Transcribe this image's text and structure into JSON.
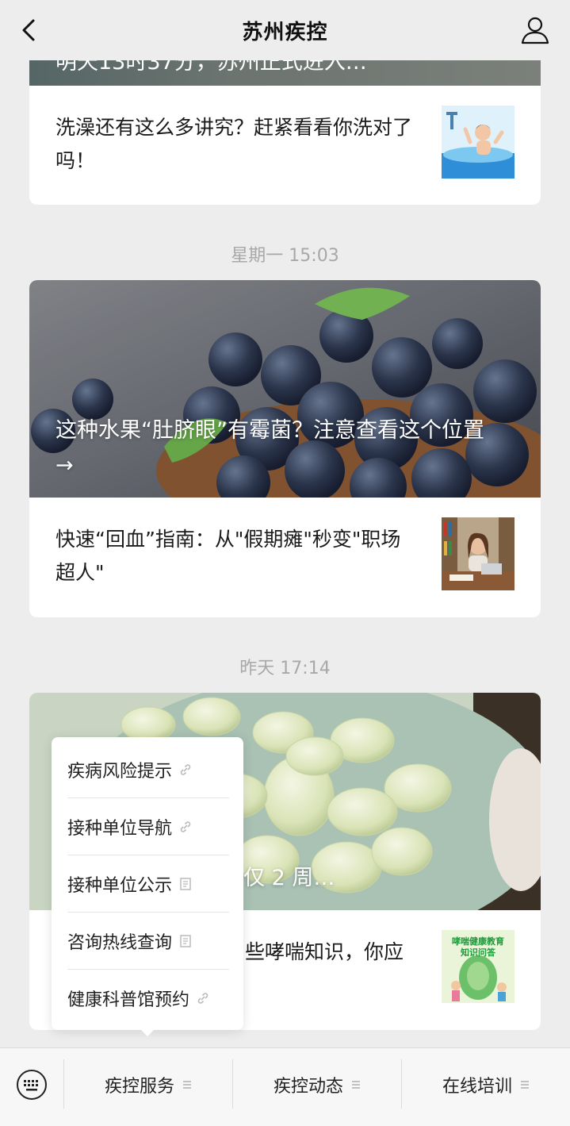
{
  "header": {
    "title": "苏州疾控",
    "back_icon": "chevron-left-icon",
    "user_icon": "user-icon"
  },
  "feed": {
    "top_partial_cover_title": "明天13时37分，苏州正式进入…",
    "top_sub_article": {
      "title": "洗澡还有这么多讲究？赶紧看看你洗对了吗！",
      "thumbnail": "bath-illustration"
    },
    "groups": [
      {
        "time": "星期一 15:03",
        "cover_title": "这种水果“肚脐眼”有霉菌？注意查看这个位置 →",
        "cover_image": "blueberries-photo",
        "sub_article": {
          "title": "快速“回血”指南：从\"假期瘫\"秒变\"职场超人\"",
          "thumbnail": "woman-studying-photo"
        }
      },
      {
        "time": "昨天 17:14",
        "cover_title_visible": "仅 2 周…",
        "cover_image": "fava-beans-photo",
        "sub_article": {
          "title_visible": "些哮喘知识，你应",
          "thumbnail": "asthma-education-poster",
          "thumbnail_text_1": "哮喘健康教育",
          "thumbnail_text_2": "知识问答"
        }
      }
    ]
  },
  "popup_menu": {
    "items": [
      {
        "label": "疾病风险提示",
        "icon": "link-icon"
      },
      {
        "label": "接种单位导航",
        "icon": "link-icon"
      },
      {
        "label": "接种单位公示",
        "icon": "article-icon"
      },
      {
        "label": "咨询热线查询",
        "icon": "article-icon"
      },
      {
        "label": "健康科普馆预约",
        "icon": "link-icon"
      }
    ]
  },
  "bottom_bar": {
    "keyboard_icon": "keyboard-icon",
    "tabs": [
      {
        "label": "疾控服务",
        "icon": "menu-icon"
      },
      {
        "label": "疾控动态",
        "icon": "menu-icon"
      },
      {
        "label": "在线培训",
        "icon": "menu-icon"
      }
    ]
  },
  "colors": {
    "background": "#ededed",
    "card": "#ffffff",
    "time_text": "#a8a8a8"
  }
}
